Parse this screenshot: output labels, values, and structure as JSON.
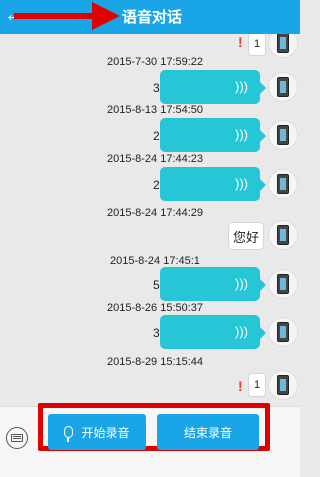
{
  "header": {
    "back_label": "←",
    "title": "语音对话"
  },
  "messages": {
    "m0": {
      "text": "1"
    },
    "m1": {
      "timestamp": "2015-7-30 17:59:22",
      "duration": "3"
    },
    "m2": {
      "timestamp": "2015-8-13 17:54:50",
      "duration": "2"
    },
    "m3": {
      "timestamp": "2015-8-24 17:44:23",
      "duration": "2"
    },
    "m4": {
      "timestamp": "2015-8-24 17:44:29",
      "text": "您好"
    },
    "m5": {
      "timestamp": "2015-8-24 17:45:1",
      "duration": "5"
    },
    "m6": {
      "timestamp": "2015-8-26 15:50:37",
      "duration": "3"
    },
    "m7": {
      "timestamp": "2015-8-29 15:15:44",
      "text": "1"
    }
  },
  "controls": {
    "start_label": "开始录音",
    "stop_label": "结束录音"
  },
  "colors": {
    "header": "#1aa6e6",
    "voice_bubble": "#26c6d6",
    "button": "#1aa6e6",
    "annotation": "#e00000",
    "error": "#e53935"
  },
  "icons": [
    "back-arrow-icon",
    "voice-wave-icon",
    "phone-avatar-icon",
    "error-icon",
    "keyboard-icon",
    "microphone-icon"
  ]
}
